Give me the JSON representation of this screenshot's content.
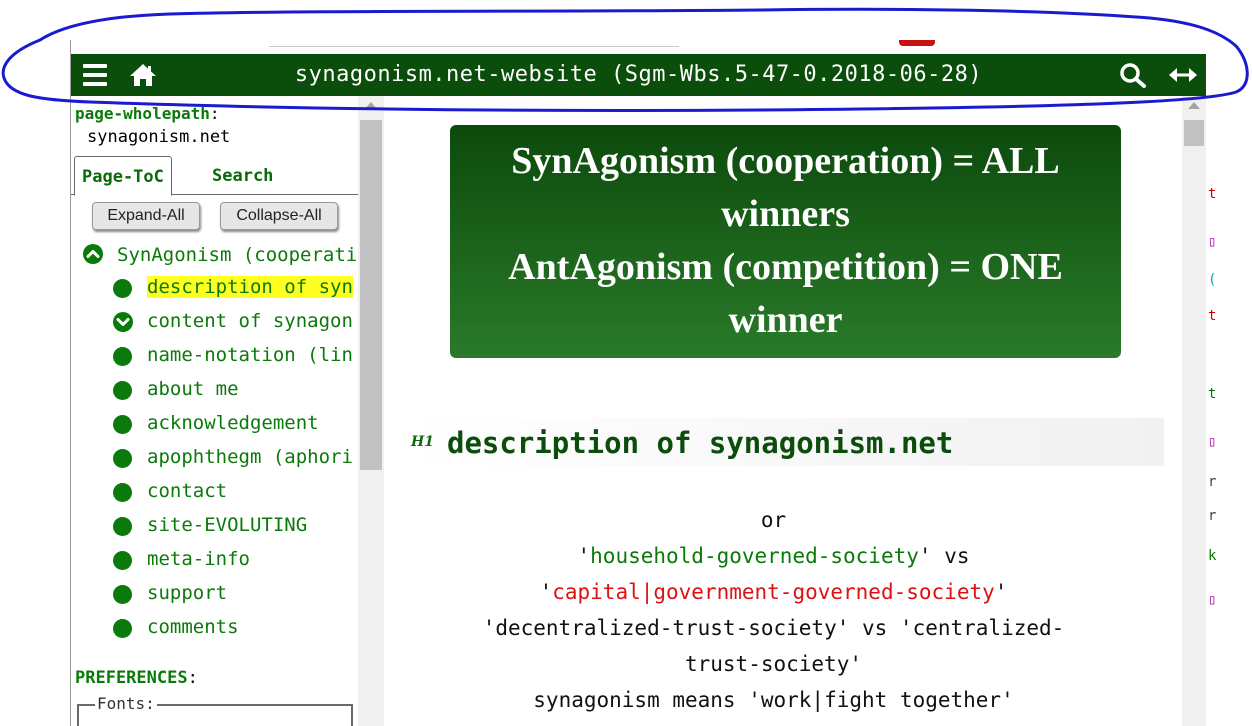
{
  "title_bar": {
    "title": "synagonism.net-website (Sgm-Wbs.5-47-0.2018-06-28)"
  },
  "sidebar": {
    "wholepath_label": "page-wholepath",
    "wholepath_colon": ":",
    "wholepath_value": "synagonism.net",
    "tabs": [
      {
        "label": "Page-ToC"
      },
      {
        "label": "Search"
      }
    ],
    "expand_all": "Expand-All",
    "collapse_all": "Collapse-All",
    "toc_root": "SynAgonism (cooperati",
    "toc_items": [
      {
        "label": "description of syn"
      },
      {
        "label": "content of synagon"
      },
      {
        "label": "name-notation (lin"
      },
      {
        "label": "about me"
      },
      {
        "label": "acknowledgement"
      },
      {
        "label": "apophthegm (aphori"
      },
      {
        "label": "contact"
      },
      {
        "label": "site-EVOLUTING"
      },
      {
        "label": "meta-info"
      },
      {
        "label": "support"
      },
      {
        "label": "comments"
      }
    ],
    "preferences_label": "PREFERENCES",
    "preferences_colon": ":",
    "fonts_legend": "Fonts:"
  },
  "main": {
    "banner": {
      "line1": "SynAgonism (cooperation) = ALL",
      "line2": "winners",
      "line3": "AntAgonism (competition) = ONE",
      "line4": "winner"
    },
    "h1_icon": "H1",
    "h1_title": "description of synagonism.net",
    "lines": {
      "or": "or",
      "q": "'",
      "household": "household-governed-society",
      "vs": " vs",
      "capital": "capital|government-governed-society",
      "decentralized": "'decentralized-trust-society' vs 'centralized-",
      "trust": "trust-society'",
      "means": "synagonism means 'work|fight together'"
    }
  },
  "colors": {
    "title_bar_bg": "#0b4d0b",
    "link_green": "#0a7a0a",
    "highlight": "#ffff22",
    "red_text": "#dd1111",
    "annotation_blue": "#1a1ad0"
  }
}
